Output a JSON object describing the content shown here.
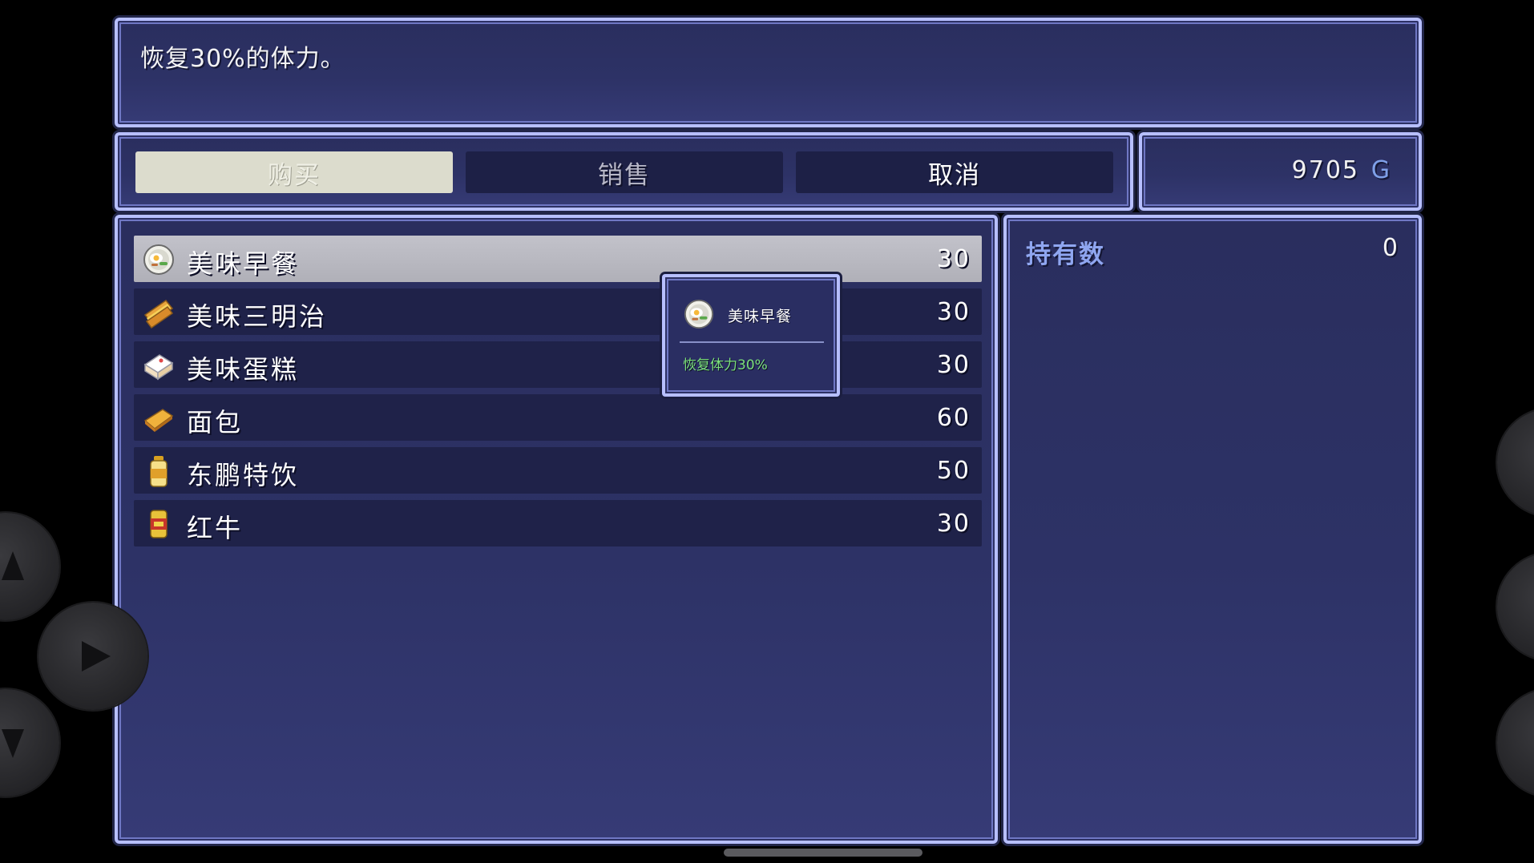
{
  "help": {
    "text": "恢复30%的体力。"
  },
  "commands": {
    "buy": "购买",
    "sell": "销售",
    "cancel": "取消"
  },
  "gold": {
    "amount": "9705",
    "unit": "G"
  },
  "items": [
    {
      "name": "美味早餐",
      "price": "30",
      "icon": "breakfast-plate-icon",
      "selected": true
    },
    {
      "name": "美味三明治",
      "price": "30",
      "icon": "sandwich-icon",
      "selected": false
    },
    {
      "name": "美味蛋糕",
      "price": "30",
      "icon": "cake-icon",
      "selected": false
    },
    {
      "name": "面包",
      "price": "60",
      "icon": "bread-icon",
      "selected": false
    },
    {
      "name": "东鹏特饮",
      "price": "50",
      "icon": "energy-drink-bottle-icon",
      "selected": false
    },
    {
      "name": "红牛",
      "price": "30",
      "icon": "energy-drink-can-icon",
      "selected": false
    }
  ],
  "tooltip": {
    "name": "美味早餐",
    "desc": "恢复体力30%",
    "icon": "breakfast-plate-icon"
  },
  "status": {
    "owned_label": "持有数",
    "owned_value": "0"
  },
  "gamepad": {
    "buttons": [
      "up-arrow-icon",
      "right-arrow-icon",
      "down-arrow-icon"
    ]
  },
  "colors": {
    "window_border": "#b7bfff",
    "window_bg": "#2d3266",
    "selected_row": "#bdbdc5",
    "tooltip_desc": "#7be07b",
    "gold_unit": "#7fa0e8",
    "owned_label": "#8fa6f0"
  }
}
